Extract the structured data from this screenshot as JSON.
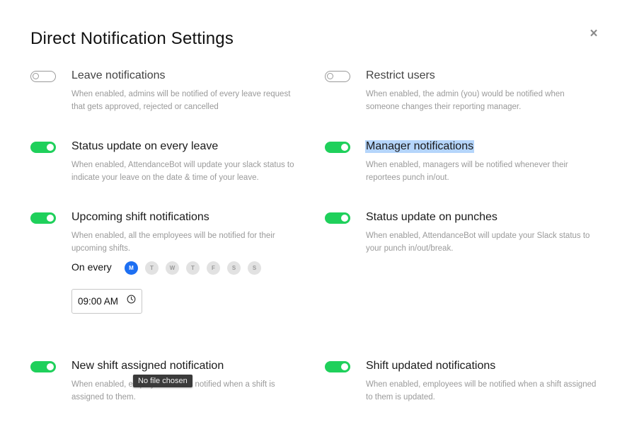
{
  "modal": {
    "title": "Direct Notification Settings",
    "close_icon": "close-icon"
  },
  "settings": [
    {
      "name": "Leave notifications",
      "enabled": false,
      "description": "When enabled, admins will be notified of every leave request that gets approved, rejected or cancelled"
    },
    {
      "name": "Restrict users",
      "enabled": false,
      "description": "When enabled, the admin (you) would be notified when someone changes their reporting manager."
    },
    {
      "name": "Status update on every leave",
      "enabled": true,
      "description": "When enabled, AttendanceBot will update your slack status to indicate your leave on the date & time of your leave."
    },
    {
      "name": "Manager notifications",
      "enabled": true,
      "selected_text": true,
      "description": "When enabled, managers will be notified whenever their reportees punch in/out."
    },
    {
      "name": "Upcoming shift notifications",
      "enabled": true,
      "description": "When enabled, all the employees will be notified for their upcoming shifts."
    },
    {
      "name": "Status update on punches",
      "enabled": true,
      "description": "When enabled, AttendanceBot will update your Slack status to your punch in/out/break."
    },
    {
      "name": "New shift assigned notification",
      "enabled": true,
      "description": "When enabled, employees will be notified when a shift is assigned to them."
    },
    {
      "name": "Shift updated notifications",
      "enabled": true,
      "description": "When enabled, employees will be notified when a shift assigned to them is updated."
    }
  ],
  "schedule": {
    "label": "On every",
    "days": [
      "M",
      "T",
      "W",
      "T",
      "F",
      "S",
      "S"
    ],
    "selected_day_index": 0,
    "time": "09:00 AM",
    "time_icon": "clock-icon"
  },
  "tooltip": {
    "text": "No file chosen"
  },
  "colors": {
    "toggle_on": "#1fd05b",
    "day_selected": "#1d6ff2",
    "selection_highlight": "#b5d5fb"
  }
}
